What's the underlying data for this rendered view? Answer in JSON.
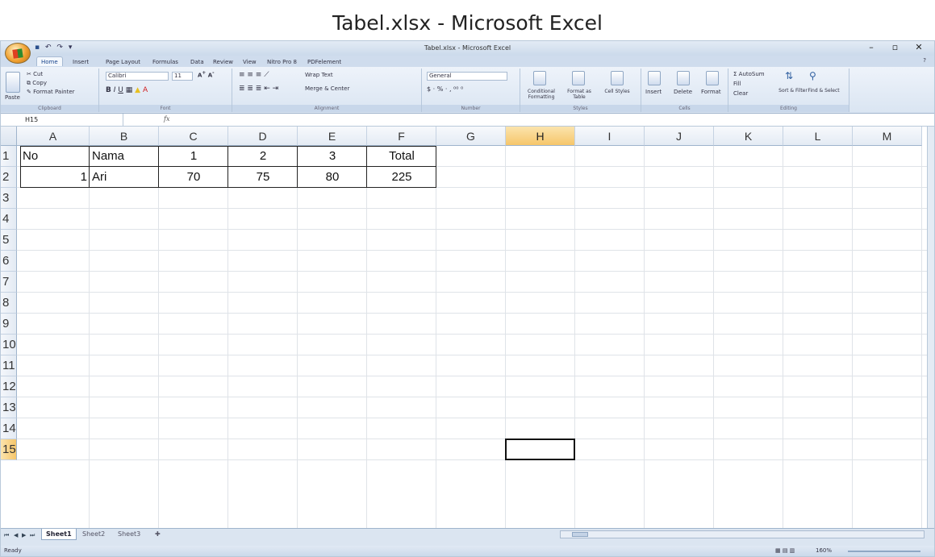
{
  "page_title": "Tabel.xlsx - Microsoft Excel",
  "window": {
    "title": "Tabel.xlsx - Microsoft Excel",
    "controls": [
      "–",
      "▫",
      "✕"
    ]
  },
  "ribbon_tabs": [
    "Home",
    "Insert",
    "Page Layout",
    "Formulas",
    "Data",
    "Review",
    "View",
    "Nitro Pro 8",
    "PDFelement"
  ],
  "ribbon": {
    "clipboard": {
      "paste": "Paste",
      "cut": "Cut",
      "copy": "Copy",
      "format_painter": "Format Painter",
      "label": "Clipboard"
    },
    "font": {
      "name": "Calibri",
      "size": "11",
      "label": "Font"
    },
    "alignment": {
      "wrap": "Wrap Text",
      "merge": "Merge & Center",
      "label": "Alignment"
    },
    "number": {
      "format": "General",
      "label": "Number"
    },
    "styles": {
      "conditional": "Conditional Formatting",
      "format_table": "Format as Table",
      "cell_styles": "Cell Styles",
      "label": "Styles"
    },
    "cells": {
      "insert": "Insert",
      "delete": "Delete",
      "format": "Format",
      "label": "Cells"
    },
    "editing": {
      "autosum": "AutoSum",
      "fill": "Fill",
      "clear": "Clear",
      "sort": "Sort & Filter",
      "find": "Find & Select",
      "label": "Editing"
    }
  },
  "formula_bar": {
    "name_box": "H15",
    "fx": "fx",
    "formula": ""
  },
  "columns": [
    "A",
    "B",
    "C",
    "D",
    "E",
    "F",
    "G",
    "H",
    "I",
    "J",
    "K",
    "L",
    "M"
  ],
  "rows": [
    "1",
    "2",
    "3",
    "4",
    "5",
    "6",
    "7",
    "8",
    "9",
    "10",
    "11",
    "12",
    "13",
    "14",
    "15"
  ],
  "cells": {
    "A1": "No",
    "B1": "Nama",
    "C1": "1",
    "D1": "2",
    "E1": "3",
    "F1": "Total",
    "A2": "1",
    "B2": "Ari",
    "C2": "70",
    "D2": "75",
    "E2": "80",
    "F2": "225"
  },
  "selected_cell": "H15",
  "sheets": [
    "Sheet1",
    "Sheet2",
    "Sheet3"
  ],
  "active_sheet": "Sheet1",
  "status": {
    "mode": "Ready",
    "zoom": "160%"
  }
}
